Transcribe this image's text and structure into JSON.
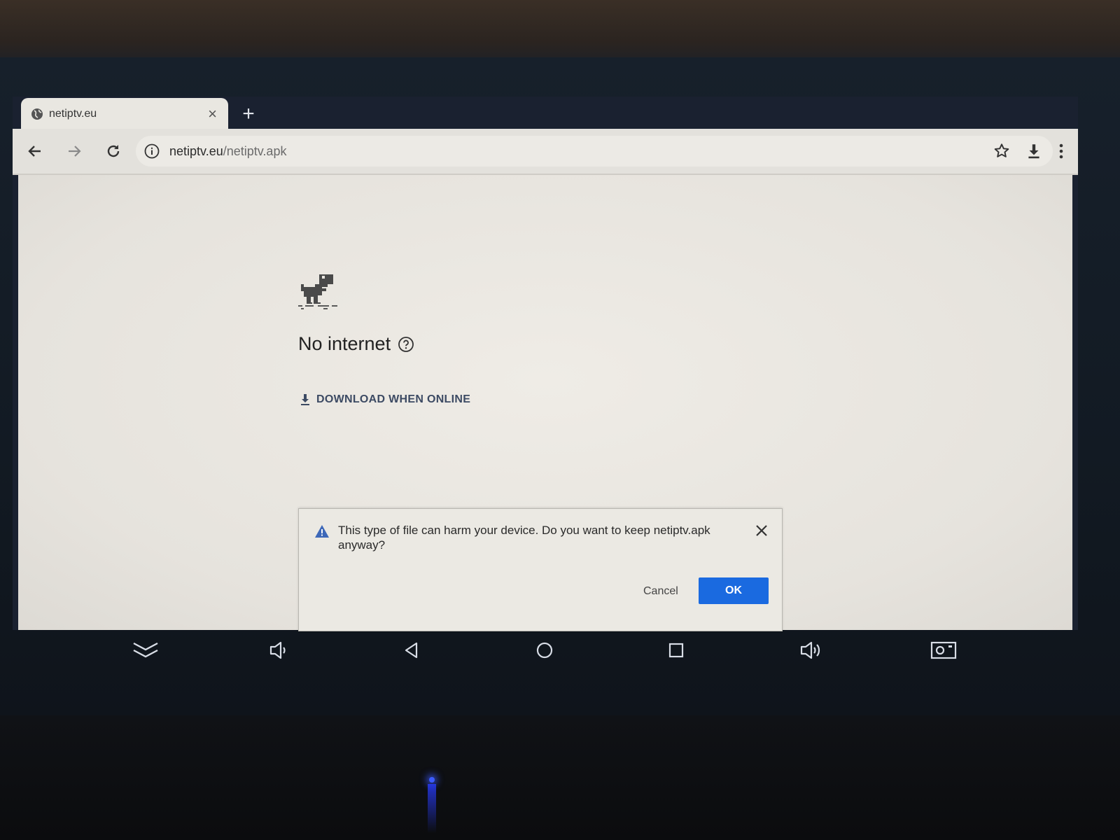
{
  "tab": {
    "title": "netiptv.eu",
    "close": "×"
  },
  "new_tab": "+",
  "omnibox": {
    "host": "netiptv.eu",
    "path": "/netiptv.apk"
  },
  "error": {
    "heading": "No internet",
    "download_when_online": "DOWNLOAD WHEN ONLINE"
  },
  "infobar": {
    "message": "This type of file can harm your device. Do you want to keep netiptv.apk anyway?",
    "cancel": "Cancel",
    "ok": "OK"
  },
  "colors": {
    "accent": "#1a6ae0",
    "link": "#3c4a63"
  },
  "icons": [
    "globe-icon",
    "close-icon",
    "back-icon",
    "forward-icon",
    "reload-icon",
    "info-icon",
    "star-icon",
    "download-icon",
    "menu-icon",
    "dino-icon",
    "help-icon",
    "warning-icon",
    "collapse-icon",
    "volume-down-icon",
    "back-nav-icon",
    "home-nav-icon",
    "recents-nav-icon",
    "volume-up-icon",
    "screenshot-icon"
  ]
}
